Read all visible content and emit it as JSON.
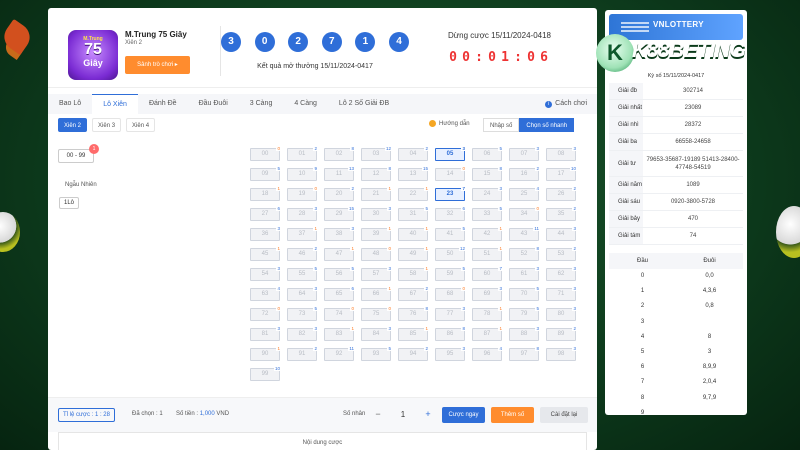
{
  "game": {
    "title": "M.Trung 75 Giây",
    "subtitle": "Xiên 2",
    "guide_button": "Sảnh trò chơi ▸",
    "logo_line1": "M.Trung",
    "logo_line2": "75",
    "logo_line3": "Giây"
  },
  "results": {
    "balls": [
      "3",
      "0",
      "2",
      "7",
      "1",
      "4"
    ],
    "label": "Kết quả mở thưởng 15/11/2024-0417"
  },
  "countdown": {
    "label": "Dừng cược 15/11/2024-0418",
    "digits": [
      "0",
      "0",
      ":",
      "0",
      "1",
      ":",
      "0",
      "6"
    ]
  },
  "tabs": [
    {
      "label": "Bao Lô",
      "active": false
    },
    {
      "label": "Lô Xiên",
      "active": true
    },
    {
      "label": "Đánh Đề",
      "active": false
    },
    {
      "label": "Đầu Đuôi",
      "active": false
    },
    {
      "label": "3 Càng",
      "active": false
    },
    {
      "label": "4 Càng",
      "active": false
    },
    {
      "label": "Lô 2 Số Giải ĐB",
      "active": false
    }
  ],
  "how_to_play": "Cách chơi",
  "subtabs": [
    {
      "label": "Xiên 2",
      "active": true
    },
    {
      "label": "Xiên 3",
      "active": false
    },
    {
      "label": "Xiên 4",
      "active": false
    }
  ],
  "guide_link": "Hướng dẫn",
  "input_modes": [
    {
      "label": "Nhập số",
      "active": false
    },
    {
      "label": "Chọn số nhanh",
      "active": true
    }
  ],
  "range_chip": "00 - 99",
  "range_badge": "1",
  "random_label": "Ngẫu Nhiên",
  "random_chip": "1Lô",
  "numbers": [
    {
      "n": "00",
      "c": "0",
      "h": 1
    },
    {
      "n": "01",
      "c": "2"
    },
    {
      "n": "02",
      "c": "8"
    },
    {
      "n": "03",
      "c": "12"
    },
    {
      "n": "04",
      "c": "2"
    },
    {
      "n": "05",
      "c": "3",
      "s": 1
    },
    {
      "n": "06",
      "c": "5"
    },
    {
      "n": "07",
      "c": "3"
    },
    {
      "n": "08",
      "c": "3"
    },
    {
      "n": "09",
      "c": "5"
    },
    {
      "n": "10",
      "c": "9"
    },
    {
      "n": "11",
      "c": "13"
    },
    {
      "n": "12",
      "c": "8"
    },
    {
      "n": "13",
      "c": "15"
    },
    {
      "n": "14",
      "c": "0",
      "h": 1
    },
    {
      "n": "15",
      "c": "8"
    },
    {
      "n": "16",
      "c": "2"
    },
    {
      "n": "17",
      "c": "10"
    },
    {
      "n": "18",
      "c": "1",
      "h": 1
    },
    {
      "n": "19",
      "c": "0",
      "h": 1
    },
    {
      "n": "20",
      "c": "2"
    },
    {
      "n": "21",
      "c": "1",
      "h": 1
    },
    {
      "n": "22",
      "c": "1",
      "h": 1
    },
    {
      "n": "23",
      "c": "7",
      "s": 1
    },
    {
      "n": "24",
      "c": "3"
    },
    {
      "n": "25",
      "c": "4"
    },
    {
      "n": "26",
      "c": "2"
    },
    {
      "n": "27",
      "c": "6"
    },
    {
      "n": "28",
      "c": "3"
    },
    {
      "n": "29",
      "c": "15"
    },
    {
      "n": "30",
      "c": "3"
    },
    {
      "n": "31",
      "c": "5"
    },
    {
      "n": "32",
      "c": "6"
    },
    {
      "n": "33",
      "c": "5"
    },
    {
      "n": "34",
      "c": "0",
      "h": 1
    },
    {
      "n": "35",
      "c": "2"
    },
    {
      "n": "36",
      "c": "3"
    },
    {
      "n": "37",
      "c": "1",
      "h": 1
    },
    {
      "n": "38",
      "c": "3"
    },
    {
      "n": "39",
      "c": "1",
      "h": 1
    },
    {
      "n": "40",
      "c": "1",
      "h": 1
    },
    {
      "n": "41",
      "c": "5"
    },
    {
      "n": "42",
      "c": "1",
      "h": 1
    },
    {
      "n": "43",
      "c": "11"
    },
    {
      "n": "44",
      "c": "3"
    },
    {
      "n": "45",
      "c": "1",
      "h": 1
    },
    {
      "n": "46",
      "c": "2"
    },
    {
      "n": "47",
      "c": "1",
      "h": 1
    },
    {
      "n": "48",
      "c": "0",
      "h": 1
    },
    {
      "n": "49",
      "c": "1",
      "h": 1
    },
    {
      "n": "50",
      "c": "12"
    },
    {
      "n": "51",
      "c": "1",
      "h": 1
    },
    {
      "n": "52",
      "c": "8"
    },
    {
      "n": "53",
      "c": "2"
    },
    {
      "n": "54",
      "c": "3"
    },
    {
      "n": "55",
      "c": "5"
    },
    {
      "n": "56",
      "c": "5"
    },
    {
      "n": "57",
      "c": "3"
    },
    {
      "n": "58",
      "c": "1",
      "h": 1
    },
    {
      "n": "59",
      "c": "5"
    },
    {
      "n": "60",
      "c": "7"
    },
    {
      "n": "61",
      "c": "3"
    },
    {
      "n": "62",
      "c": "3"
    },
    {
      "n": "63",
      "c": "4"
    },
    {
      "n": "64",
      "c": "3"
    },
    {
      "n": "65",
      "c": "6"
    },
    {
      "n": "66",
      "c": "1",
      "h": 1
    },
    {
      "n": "67",
      "c": "2"
    },
    {
      "n": "68",
      "c": "0",
      "h": 1
    },
    {
      "n": "69",
      "c": "3"
    },
    {
      "n": "70",
      "c": "5"
    },
    {
      "n": "71",
      "c": "3"
    },
    {
      "n": "72",
      "c": "0",
      "h": 1
    },
    {
      "n": "73",
      "c": "5"
    },
    {
      "n": "74",
      "c": "0",
      "h": 1
    },
    {
      "n": "75",
      "c": "0",
      "h": 1
    },
    {
      "n": "76",
      "c": "8"
    },
    {
      "n": "77",
      "c": "3"
    },
    {
      "n": "78",
      "c": "1",
      "h": 1
    },
    {
      "n": "79",
      "c": "5"
    },
    {
      "n": "80",
      "c": "3"
    },
    {
      "n": "81",
      "c": "3"
    },
    {
      "n": "82",
      "c": "3"
    },
    {
      "n": "83",
      "c": "1",
      "h": 1
    },
    {
      "n": "84",
      "c": "3"
    },
    {
      "n": "85",
      "c": "1",
      "h": 1
    },
    {
      "n": "86",
      "c": "8"
    },
    {
      "n": "87",
      "c": "1",
      "h": 1
    },
    {
      "n": "88",
      "c": "3"
    },
    {
      "n": "89",
      "c": "2"
    },
    {
      "n": "90",
      "c": "1",
      "h": 1
    },
    {
      "n": "91",
      "c": "2"
    },
    {
      "n": "92",
      "c": "11"
    },
    {
      "n": "93",
      "c": "5"
    },
    {
      "n": "94",
      "c": "2"
    },
    {
      "n": "95",
      "c": "3"
    },
    {
      "n": "96",
      "c": "4"
    },
    {
      "n": "97",
      "c": "8"
    },
    {
      "n": "98",
      "c": "3"
    },
    {
      "n": "99",
      "c": "10"
    }
  ],
  "footer": {
    "ratio": "Tỉ lệ cược : 1 : 28",
    "chosen": "Đã chọn : 1",
    "amount_label": "Số tiền : ",
    "amount_value": "1,000",
    "amount_unit": " VND",
    "multiplier_label": "Số nhân",
    "multiplier_value": "1",
    "bet_button": "Cược ngay",
    "add_button": "Thêm số",
    "reset_button": "Cài đặt lại"
  },
  "content_header": "Nội dung cược",
  "right_panel": {
    "brand": "VNLOTTERY",
    "draw_id": "Kỳ số 15/11/2024-0417",
    "prizes": [
      {
        "name": "Giải đb",
        "value": "302714"
      },
      {
        "name": "Giải nhất",
        "value": "23089"
      },
      {
        "name": "Giải nhì",
        "value": "28372"
      },
      {
        "name": "Giải ba",
        "value": "66558-24658"
      },
      {
        "name": "Giải tư",
        "value": "79653-35687-19189 51413-28400-47748-54519"
      },
      {
        "name": "Giải năm",
        "value": "1089"
      },
      {
        "name": "Giải sáu",
        "value": "0920-3800-5728"
      },
      {
        "name": "Giải bảy",
        "value": "470"
      },
      {
        "name": "Giải tám",
        "value": "74"
      }
    ],
    "dau_duoi_header": [
      "Đầu",
      "Đuôi"
    ],
    "dau_duoi": [
      {
        "dau": "0",
        "duoi": "0,0"
      },
      {
        "dau": "1",
        "duoi": "4,3,6"
      },
      {
        "dau": "2",
        "duoi": "0,8"
      },
      {
        "dau": "3",
        "duoi": ""
      },
      {
        "dau": "4",
        "duoi": "8"
      },
      {
        "dau": "5",
        "duoi": "3"
      },
      {
        "dau": "6",
        "duoi": "8,9,9"
      },
      {
        "dau": "7",
        "duoi": "2,0,4"
      },
      {
        "dau": "8",
        "duoi": "9,7,9"
      },
      {
        "dau": "9",
        "duoi": ""
      }
    ]
  },
  "site_brand": {
    "prefix": "K",
    "main": "K88BETING"
  }
}
